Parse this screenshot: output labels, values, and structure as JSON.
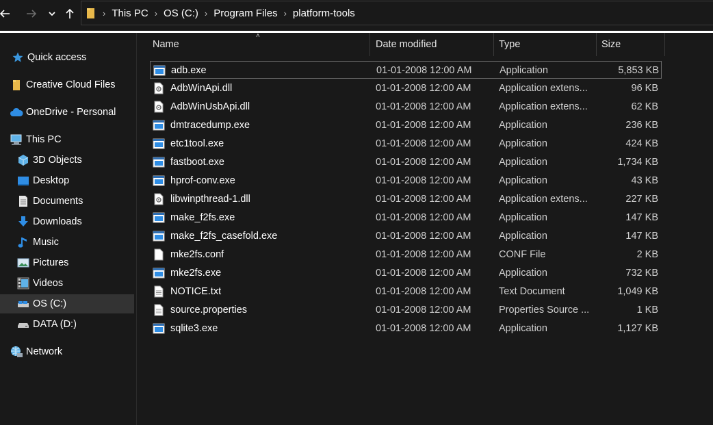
{
  "nav": {
    "back_icon": "arrow-left-icon",
    "forward_icon": "arrow-right-icon",
    "recent_icon": "chevron-down-icon",
    "up_icon": "arrow-up-icon"
  },
  "breadcrumb": [
    "This PC",
    "OS (C:)",
    "Program Files",
    "platform-tools"
  ],
  "sidebar": {
    "items": [
      {
        "label": "Quick access",
        "icon": "star-icon"
      },
      {
        "label": "Creative Cloud Files",
        "icon": "folder-icon"
      },
      {
        "label": "OneDrive - Personal",
        "icon": "cloud-icon"
      },
      {
        "label": "This PC",
        "icon": "computer-icon"
      },
      {
        "label": "3D Objects",
        "icon": "cube-icon"
      },
      {
        "label": "Desktop",
        "icon": "desktop-icon"
      },
      {
        "label": "Documents",
        "icon": "document-icon"
      },
      {
        "label": "Downloads",
        "icon": "download-icon"
      },
      {
        "label": "Music",
        "icon": "music-icon"
      },
      {
        "label": "Pictures",
        "icon": "picture-icon"
      },
      {
        "label": "Videos",
        "icon": "video-icon"
      },
      {
        "label": "OS (C:)",
        "icon": "drive-icon"
      },
      {
        "label": "DATA (D:)",
        "icon": "drive-icon"
      },
      {
        "label": "Network",
        "icon": "network-icon"
      }
    ]
  },
  "columns": {
    "name": "Name",
    "date": "Date modified",
    "type": "Type",
    "size": "Size"
  },
  "files": [
    {
      "name": "adb.exe",
      "date": "01-01-2008 12:00 AM",
      "type": "Application",
      "size": "5,853 KB",
      "icon": "exe-icon"
    },
    {
      "name": "AdbWinApi.dll",
      "date": "01-01-2008 12:00 AM",
      "type": "Application extens...",
      "size": "96 KB",
      "icon": "dll-icon"
    },
    {
      "name": "AdbWinUsbApi.dll",
      "date": "01-01-2008 12:00 AM",
      "type": "Application extens...",
      "size": "62 KB",
      "icon": "dll-icon"
    },
    {
      "name": "dmtracedump.exe",
      "date": "01-01-2008 12:00 AM",
      "type": "Application",
      "size": "236 KB",
      "icon": "exe-icon"
    },
    {
      "name": "etc1tool.exe",
      "date": "01-01-2008 12:00 AM",
      "type": "Application",
      "size": "424 KB",
      "icon": "exe-icon"
    },
    {
      "name": "fastboot.exe",
      "date": "01-01-2008 12:00 AM",
      "type": "Application",
      "size": "1,734 KB",
      "icon": "exe-icon"
    },
    {
      "name": "hprof-conv.exe",
      "date": "01-01-2008 12:00 AM",
      "type": "Application",
      "size": "43 KB",
      "icon": "exe-icon"
    },
    {
      "name": "libwinpthread-1.dll",
      "date": "01-01-2008 12:00 AM",
      "type": "Application extens...",
      "size": "227 KB",
      "icon": "dll-icon"
    },
    {
      "name": "make_f2fs.exe",
      "date": "01-01-2008 12:00 AM",
      "type": "Application",
      "size": "147 KB",
      "icon": "exe-icon"
    },
    {
      "name": "make_f2fs_casefold.exe",
      "date": "01-01-2008 12:00 AM",
      "type": "Application",
      "size": "147 KB",
      "icon": "exe-icon"
    },
    {
      "name": "mke2fs.conf",
      "date": "01-01-2008 12:00 AM",
      "type": "CONF File",
      "size": "2 KB",
      "icon": "blank-file-icon"
    },
    {
      "name": "mke2fs.exe",
      "date": "01-01-2008 12:00 AM",
      "type": "Application",
      "size": "732 KB",
      "icon": "exe-icon"
    },
    {
      "name": "NOTICE.txt",
      "date": "01-01-2008 12:00 AM",
      "type": "Text Document",
      "size": "1,049 KB",
      "icon": "text-file-icon"
    },
    {
      "name": "source.properties",
      "date": "01-01-2008 12:00 AM",
      "type": "Properties Source ...",
      "size": "1 KB",
      "icon": "text-file-icon"
    },
    {
      "name": "sqlite3.exe",
      "date": "01-01-2008 12:00 AM",
      "type": "Application",
      "size": "1,127 KB",
      "icon": "exe-icon"
    }
  ],
  "colors": {
    "background": "#191919",
    "selected": "#333333",
    "text": "#ffffff"
  }
}
